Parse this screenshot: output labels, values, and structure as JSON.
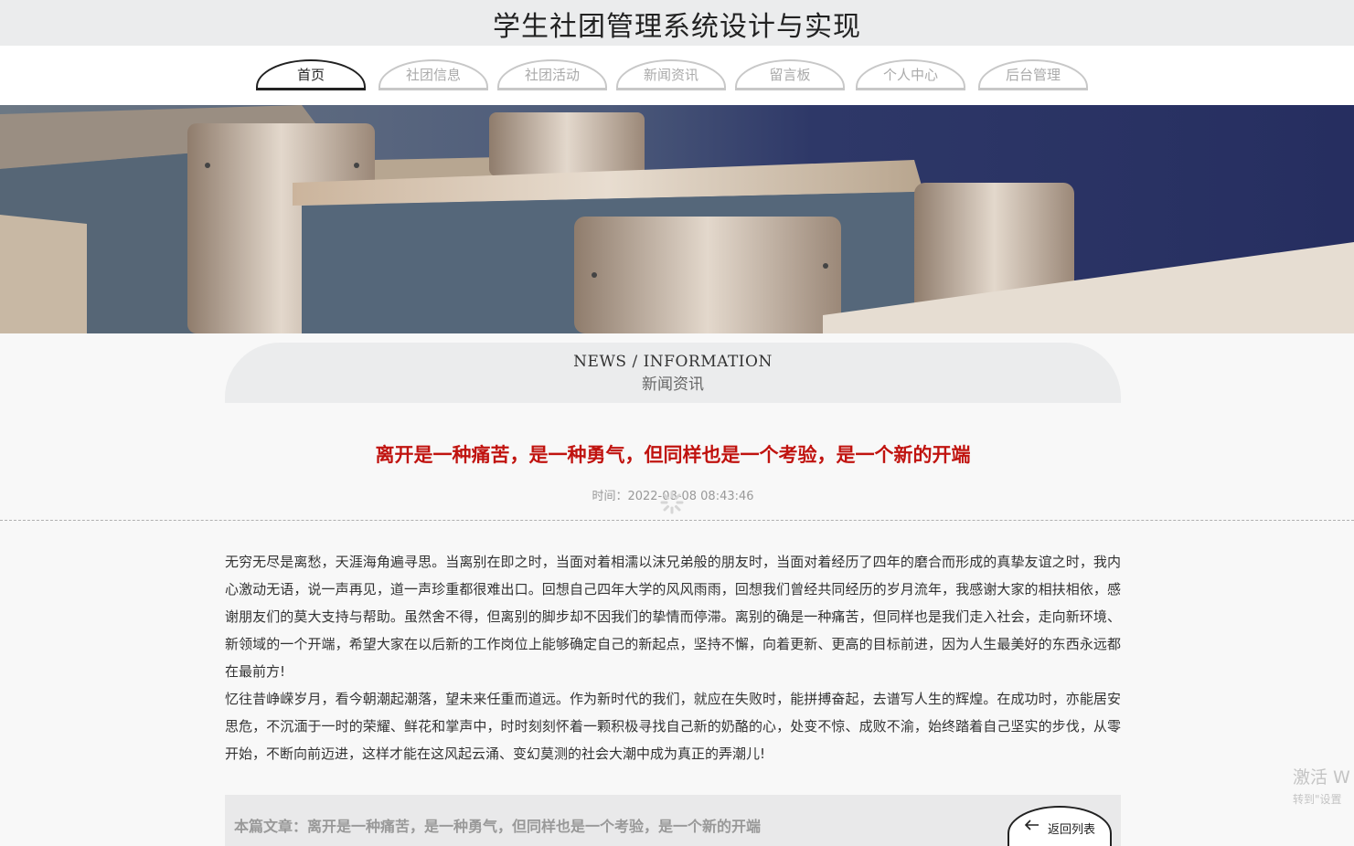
{
  "app": {
    "title": "学生社团管理系统设计与实现"
  },
  "nav": {
    "items": [
      {
        "label": "首页"
      },
      {
        "label": "社团信息"
      },
      {
        "label": "社团活动"
      },
      {
        "label": "新闻资讯"
      },
      {
        "label": "留言板"
      },
      {
        "label": "个人中心"
      },
      {
        "label": "后台管理"
      }
    ],
    "active_index": 0
  },
  "section": {
    "title_en": "NEWS / INFORMATION",
    "title_cn": "新闻资讯"
  },
  "article": {
    "title": "离开是一种痛苦，是一种勇气，但同样也是一个考验，是一个新的开端",
    "time_label": "时间：",
    "time_value": "2022-08-08 08:43:46",
    "paragraphs": [
      "无穷无尽是离愁，天涯海角遍寻思。当离别在即之时，当面对着相濡以沫兄弟般的朋友时，当面对着经历了四年的磨合而形成的真挚友谊之时，我内心激动无语，说一声再见，道一声珍重都很难出口。回想自己四年大学的风风雨雨，回想我们曾经共同经历的岁月流年，我感谢大家的相扶相依，感谢朋友们的莫大支持与帮助。虽然舍不得，但离别的脚步却不因我们的挚情而停滞。离别的确是一种痛苦，但同样也是我们走入社会，走向新环境、新领域的一个开端，希望大家在以后新的工作岗位上能够确定自己的新起点，坚持不懈，向着更新、更高的目标前进，因为人生最美好的东西永远都在最前方!",
      "忆往昔峥嵘岁月，看今朝潮起潮落，望未来任重而道远。作为新时代的我们，就应在失败时，能拼搏奋起，去谱写人生的辉煌。在成功时，亦能居安思危，不沉湎于一时的荣耀、鲜花和掌声中，时时刻刻怀着一颗积极寻找自己新的奶酪的心，处变不惊、成败不渝，始终踏着自己坚实的步伐，从零开始，不断向前迈进，这样才能在这风起云涌、变幻莫测的社会大潮中成为真正的弄潮儿!"
    ]
  },
  "footer": {
    "current_label": "本篇文章：离开是一种痛苦，是一种勇气，但同样也是一个考验，是一个新的开端",
    "back_label": "返回列表"
  },
  "watermark": {
    "line1": "激活 W",
    "line2": "转到\"设置"
  },
  "colors": {
    "accent": "#c0130f",
    "nav_active": "#222222",
    "nav_inactive": "#aaaaaa"
  }
}
